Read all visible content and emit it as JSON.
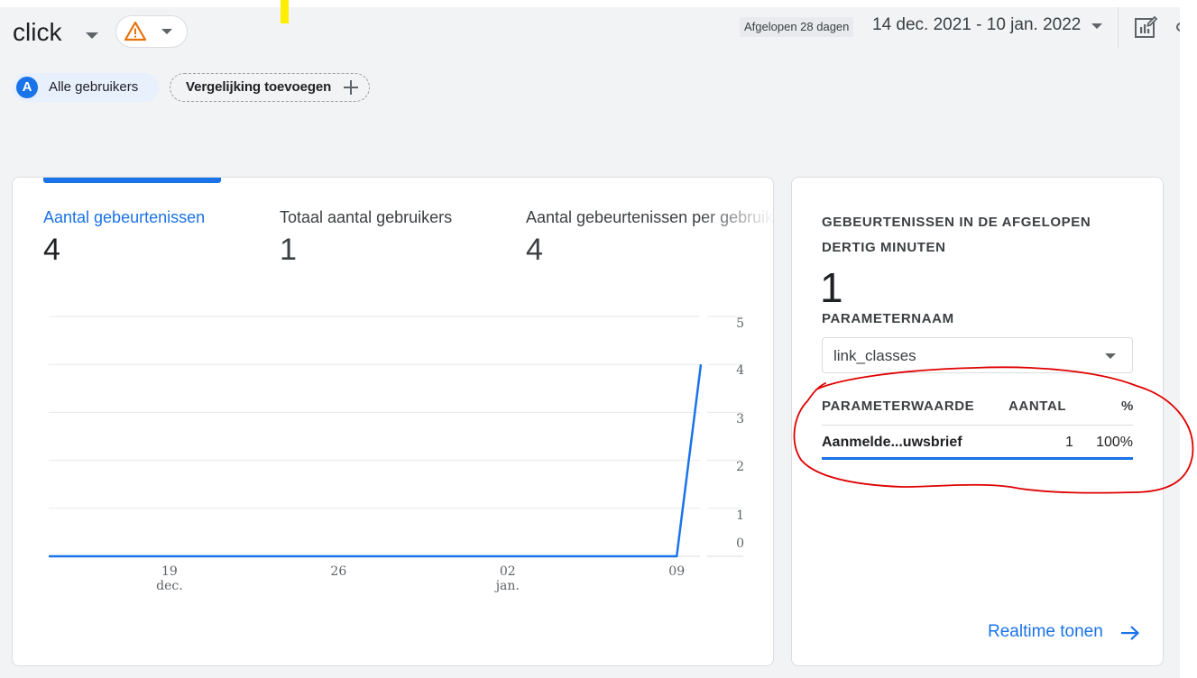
{
  "header": {
    "title": "click",
    "period_label": "Afgelopen 28 dagen",
    "date_range": "14 dec. 2021 - 10 jan. 2022",
    "icons": [
      "warning-icon",
      "chevron-down-icon",
      "edit-report-icon"
    ]
  },
  "filters": {
    "segment_avatar": "A",
    "segment_label": "Alle gebruikers",
    "compare_label": "Vergelijking toevoegen"
  },
  "metrics": [
    {
      "label": "Aantal gebeurtenissen",
      "value": "4",
      "active": true
    },
    {
      "label": "Totaal aantal gebruikers",
      "value": "1",
      "active": false
    },
    {
      "label": "Aantal gebeurtenissen per gebruiker",
      "value": "4",
      "active": false
    }
  ],
  "chart_data": {
    "type": "line",
    "x_ticks": [
      {
        "line1": "19",
        "line2": "dec."
      },
      {
        "line1": "26",
        "line2": ""
      },
      {
        "line1": "02",
        "line2": "jan."
      },
      {
        "line1": "09",
        "line2": ""
      }
    ],
    "y_ticks": [
      "5",
      "4",
      "3",
      "2",
      "1",
      "0"
    ],
    "ylim": [
      0,
      5
    ],
    "x_dates": [
      "2021-12-14",
      "2021-12-15",
      "2021-12-16",
      "2021-12-17",
      "2021-12-18",
      "2021-12-19",
      "2021-12-20",
      "2021-12-21",
      "2021-12-22",
      "2021-12-23",
      "2021-12-24",
      "2021-12-25",
      "2021-12-26",
      "2021-12-27",
      "2021-12-28",
      "2021-12-29",
      "2021-12-30",
      "2021-12-31",
      "2022-01-01",
      "2022-01-02",
      "2022-01-03",
      "2022-01-04",
      "2022-01-05",
      "2022-01-06",
      "2022-01-07",
      "2022-01-08",
      "2022-01-09",
      "2022-01-10"
    ],
    "series": [
      {
        "values": [
          0,
          0,
          0,
          0,
          0,
          0,
          0,
          0,
          0,
          0,
          0,
          0,
          0,
          0,
          0,
          0,
          0,
          0,
          0,
          0,
          0,
          0,
          0,
          0,
          0,
          0,
          0,
          4
        ],
        "color": "#1a73e8"
      }
    ],
    "grid": true
  },
  "realtime": {
    "title": "GEBEURTENISSEN IN DE AFGELOPEN DERTIG MINUTEN",
    "value": "1",
    "param_label": "PARAMETERNAAM",
    "param_selected": "link_classes",
    "col_value": "PARAMETERWAARDE",
    "col_count": "AANTAL",
    "col_pct": "%",
    "rows": [
      {
        "value": "Aanmelde...uwsbrief",
        "count": "1",
        "pct": "100%"
      }
    ],
    "link": "Realtime tonen"
  },
  "colors": {
    "accent": "#1a73e8",
    "warning": "#e8710a",
    "annotation": "#e00000",
    "highlight": "#ffee00"
  }
}
